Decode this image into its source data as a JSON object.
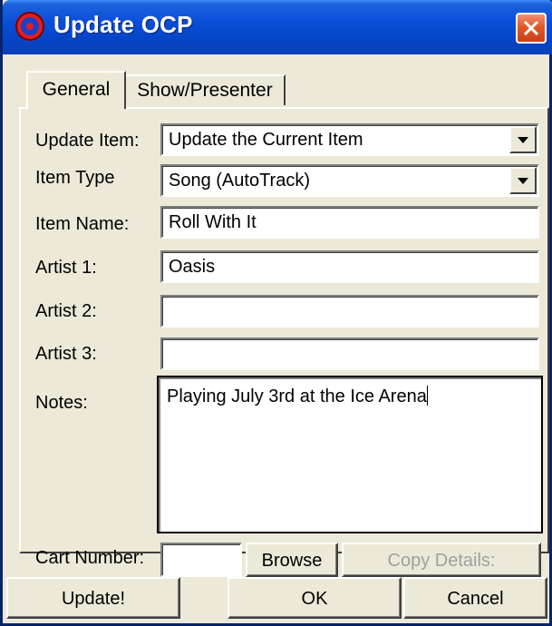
{
  "window": {
    "title": "Update OCP"
  },
  "tabs": [
    {
      "label": "General",
      "active": true
    },
    {
      "label": "Show/Presenter",
      "active": false
    }
  ],
  "form": {
    "update_item": {
      "label": "Update Item:",
      "value": "Update the Current Item"
    },
    "item_type": {
      "label": "Item Type",
      "value": "Song (AutoTrack)"
    },
    "item_name": {
      "label": "Item Name:",
      "value": "Roll With It"
    },
    "artist1": {
      "label": "Artist 1:",
      "value": "Oasis"
    },
    "artist2": {
      "label": "Artist 2:",
      "value": ""
    },
    "artist3": {
      "label": "Artist 3:",
      "value": ""
    },
    "notes": {
      "label": "Notes:",
      "value": "Playing July 3rd at the Ice Arena"
    },
    "cart_number": {
      "label": "Cart Number:",
      "value": ""
    }
  },
  "buttons": {
    "browse": "Browse",
    "copy_details": "Copy Details:",
    "update": "Update!",
    "ok": "OK",
    "cancel": "Cancel"
  },
  "colors": {
    "titlebar": "#0A4FD8",
    "face": "#ECE9D8",
    "close": "#E05A2A"
  }
}
